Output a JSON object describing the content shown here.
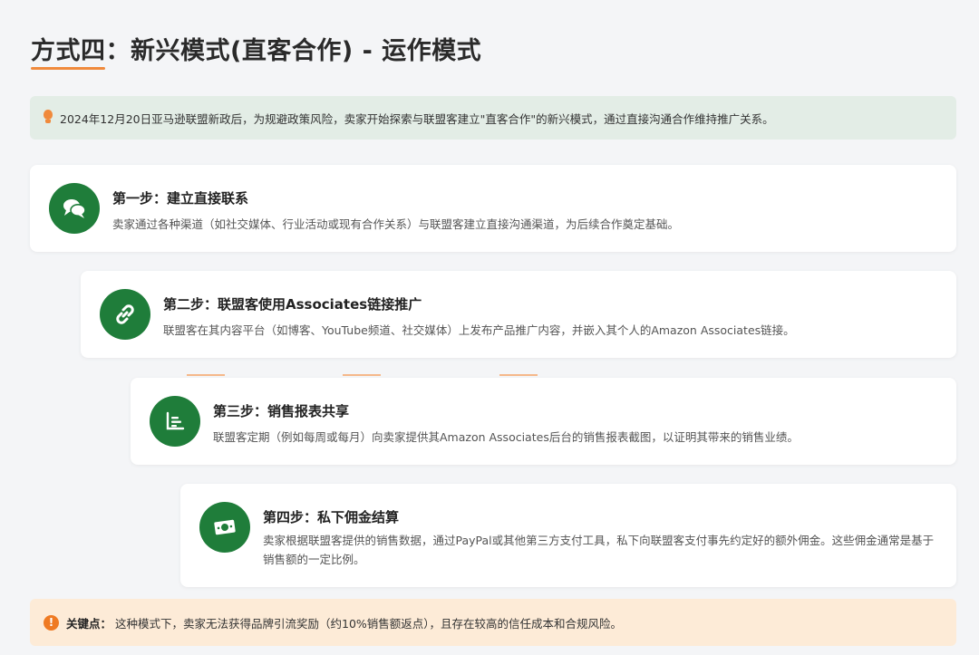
{
  "page": {
    "title": "方式四：新兴模式(直客合作) - 运作模式"
  },
  "colors": {
    "accent": "#f08a3c",
    "brand_green": "#1f7d3a",
    "notice_bg": "#e3ede6",
    "keypoint_bg": "#fdebd7"
  },
  "notice": {
    "icon": "lightbulb-icon",
    "text": "2024年12月20日亚马逊联盟新政后，为规避政策风险，卖家开始探索与联盟客建立\"直客合作\"的新兴模式，通过直接沟通合作维持推广关系。"
  },
  "steps": [
    {
      "icon": "chat-bubbles-icon",
      "title": "第一步：建立直接联系",
      "desc": "卖家通过各种渠道（如社交媒体、行业活动或现有合作关系）与联盟客建立直接沟通渠道，为后续合作奠定基础。"
    },
    {
      "icon": "link-icon",
      "title": "第二步：联盟客使用Associates链接推广",
      "desc": "联盟客在其内容平台（如博客、YouTube频道、社交媒体）上发布产品推广内容，并嵌入其个人的Amazon Associates链接。"
    },
    {
      "icon": "bar-chart-icon",
      "title": "第三步：销售报表共享",
      "desc": "联盟客定期（例如每周或每月）向卖家提供其Amazon Associates后台的销售报表截图，以证明其带来的销售业绩。"
    },
    {
      "icon": "money-icon",
      "title": "第四步：私下佣金结算",
      "desc": "卖家根据联盟客提供的销售数据，通过PayPal或其他第三方支付工具，私下向联盟客支付事先约定好的额外佣金。这些佣金通常是基于销售额的一定比例。"
    }
  ],
  "keypoint": {
    "icon": "exclamation-icon",
    "label": "关键点：",
    "text": "这种模式下，卖家无法获得品牌引流奖励（约10%销售额返点），且存在较高的信任成本和合规风险。"
  }
}
